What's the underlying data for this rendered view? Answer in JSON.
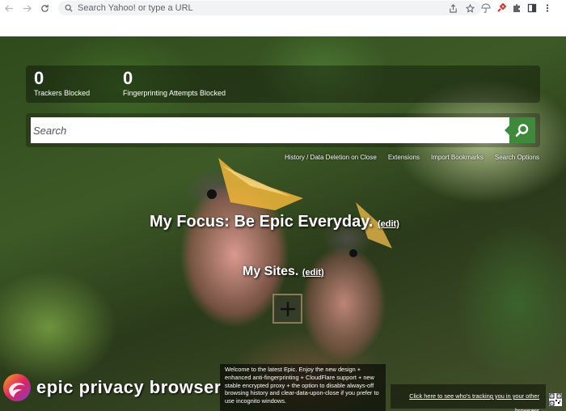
{
  "browser": {
    "omnibox_placeholder": "Search Yahoo! or type a URL",
    "icons": [
      "back-icon",
      "forward-icon",
      "reload-icon",
      "search-icon",
      "share-icon",
      "star-icon",
      "umbrella-icon",
      "extension-red-icon",
      "puzzle-icon",
      "sidebar-icon",
      "more-icon"
    ]
  },
  "counters": {
    "trackers": {
      "value": "0",
      "label": "Trackers Blocked"
    },
    "fingerprinting": {
      "value": "0",
      "label": "Fingerprinting Attempts Blocked"
    }
  },
  "search": {
    "placeholder": "Search"
  },
  "links": [
    "History / Data Deletion on Close",
    "Extensions",
    "Import Bookmarks",
    "Search Options"
  ],
  "focus": {
    "text": "My Focus: Be Epic Everyday.",
    "edit": "(edit)"
  },
  "sites": {
    "text": "My Sites.",
    "edit": "(edit)"
  },
  "brand": "epic privacy browser",
  "welcome": "Welcome to the latest Epic. Enjoy the new design + enhanced anti-fingerprinting + CloudFlare support + new stable encrypted proxy + the option to disable always-off browsing history and clear-data-upon-close if you prefer to use incognito windows.",
  "tracking_link": "Click here to see who's tracking you in your other browsers",
  "colors": {
    "search_button": "#3e8a3a",
    "logo_gradient": [
      "#f5a623",
      "#e0245e",
      "#7b3fc4"
    ]
  }
}
